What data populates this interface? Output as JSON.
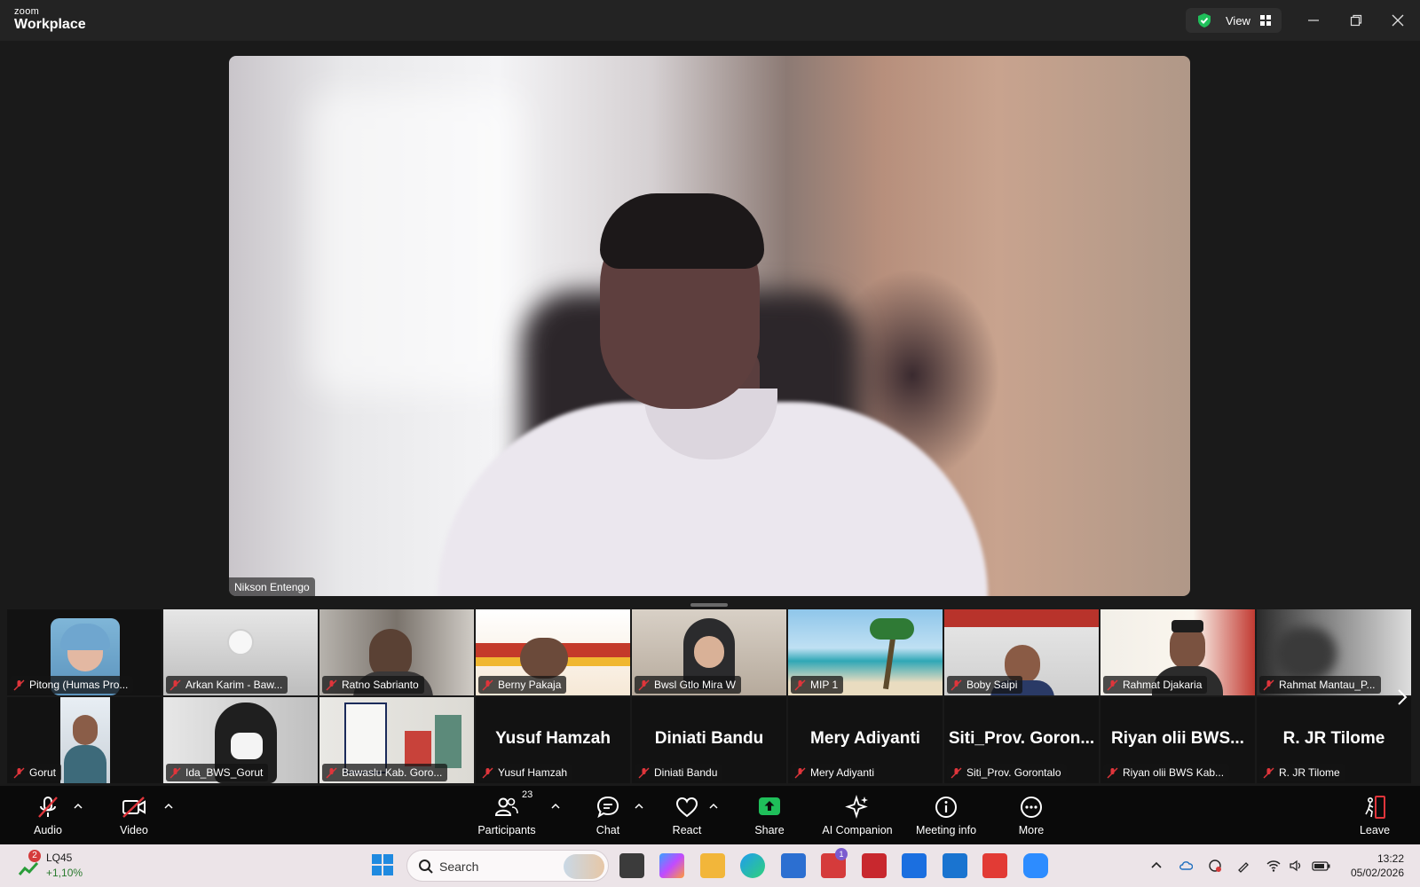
{
  "app": {
    "logo_top": "zoom",
    "logo_bottom": "Workplace",
    "view_label": "View"
  },
  "speaker": {
    "name": "Nikson Entengo"
  },
  "gallery": {
    "row1": [
      {
        "name": "Pitong (Humas Pro...",
        "thumb": "avatar"
      },
      {
        "name": "Arkan Karim - Baw...",
        "thumb": "wall-clock"
      },
      {
        "name": "Ratno Sabrianto",
        "thumb": "office"
      },
      {
        "name": "Berny Pakaja",
        "thumb": "banner"
      },
      {
        "name": "Bwsl Gtlo Mira W",
        "thumb": "hijab"
      },
      {
        "name": "MIP 1",
        "thumb": "beach"
      },
      {
        "name": "Boby Saipi",
        "thumb": "building"
      },
      {
        "name": "Rahmat Djakaria",
        "thumb": "poster"
      },
      {
        "name": "Rahmat Mantau_P...",
        "thumb": "dark"
      }
    ],
    "row2": [
      {
        "name": "Gorut",
        "thumb": "portrait",
        "big": ""
      },
      {
        "name": "Ida_BWS_Gorut",
        "thumb": "mask",
        "big": ""
      },
      {
        "name": "Bawaslu Kab. Goro...",
        "thumb": "art",
        "big": ""
      },
      {
        "name": "Yusuf Hamzah",
        "thumb": "none",
        "big": "Yusuf Hamzah"
      },
      {
        "name": "Diniati Bandu",
        "thumb": "none",
        "big": "Diniati Bandu"
      },
      {
        "name": "Mery Adiyanti",
        "thumb": "none",
        "big": "Mery Adiyanti"
      },
      {
        "name": "Siti_Prov. Gorontalo",
        "thumb": "none",
        "big": "Siti_Prov. Goron..."
      },
      {
        "name": "Riyan olii BWS Kab...",
        "thumb": "none",
        "big": "Riyan olii BWS..."
      },
      {
        "name": "R. JR Tilome",
        "thumb": "none",
        "big": "R. JR Tilome"
      }
    ]
  },
  "toolbar": {
    "audio": "Audio",
    "video": "Video",
    "participants": "Participants",
    "participants_count": "23",
    "chat": "Chat",
    "react": "React",
    "share": "Share",
    "ai_companion": "AI Companion",
    "meeting_info": "Meeting info",
    "more": "More",
    "leave": "Leave"
  },
  "taskbar": {
    "stock_badge": "2",
    "stock_ticker": "LQ45",
    "stock_change": "+1,10%",
    "search_placeholder": "Search",
    "time": "13:22",
    "date": "05/02/2026",
    "teams_badge": "1"
  },
  "colors": {
    "toolbar_bg": "#0a0a0a",
    "share_green": "#1fbf5a",
    "mute_red": "#e0353b",
    "leave_red": "#e0353b"
  }
}
